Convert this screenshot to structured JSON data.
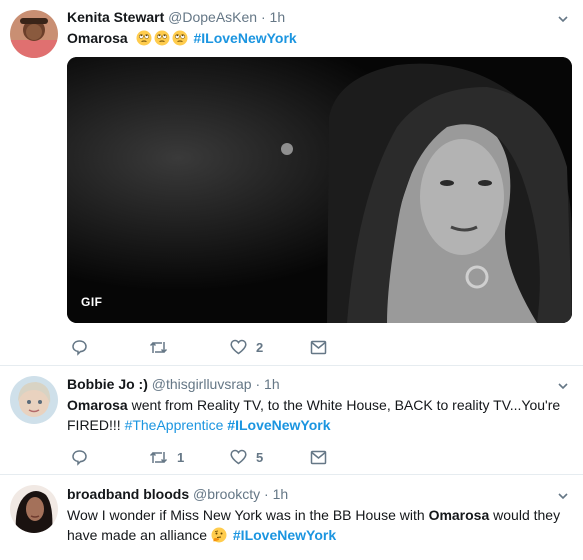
{
  "tweets": [
    {
      "name": "Kenita Stewart",
      "handle": "@DopeAsKen",
      "dot": "·",
      "time": "1h",
      "text_bold": "Omarosa",
      "hashtag": "#ILoveNewYork",
      "emojis": [
        "rolling-eyes-icon",
        "rolling-eyes-icon",
        "rolling-eyes-icon"
      ],
      "media_badge": "GIF",
      "reply_count": "",
      "retweet_count": "",
      "like_count": "2"
    },
    {
      "name": "Bobbie Jo :)",
      "handle": "@thisgirlluvsrap",
      "dot": "·",
      "time": "1h",
      "text_bold": "Omarosa",
      "text_rest": " went from Reality TV, to the White House, BACK to reality TV...You're FIRED!!! ",
      "hashtag1": "#TheApprentice",
      "hashtag2": "#ILoveNewYork",
      "reply_count": "",
      "retweet_count": "1",
      "like_count": "5"
    },
    {
      "name": "broadband bloods",
      "handle": "@brookcty",
      "dot": "·",
      "time": "1h",
      "text_pre": "Wow I wonder if Miss New York was in the BB House with ",
      "text_bold": "Omarosa",
      "text_post": " would they have made an alliance ",
      "emoji": "thinking-face-icon",
      "hashtag": "#ILoveNewYork"
    }
  ],
  "colors": {
    "accent": "#1b95e0",
    "muted": "#657786",
    "border": "#e6ecf0"
  }
}
